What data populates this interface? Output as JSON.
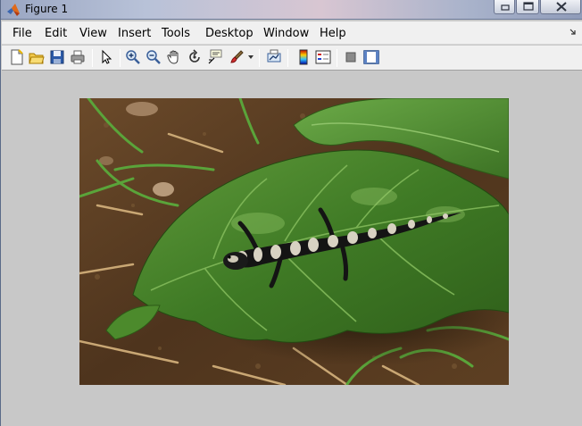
{
  "window": {
    "title": "Figure 1",
    "icon": "matlab-icon"
  },
  "menu": {
    "items": [
      "File",
      "Edit",
      "View",
      "Insert",
      "Tools",
      "Desktop",
      "Window",
      "Help"
    ]
  },
  "toolbar": {
    "buttons": [
      "new-figure-icon",
      "open-file-icon",
      "save-icon",
      "print-icon",
      "edit-plot-icon",
      "zoom-in-icon",
      "zoom-out-icon",
      "pan-icon",
      "rotate-3d-icon",
      "data-cursor-icon",
      "brush-icon",
      "link-plot-icon",
      "colorbar-icon",
      "legend-icon",
      "hide-plot-tools-icon",
      "show-plot-tools-icon"
    ]
  },
  "figure": {
    "content": "image-of-salamander-on-leaf"
  }
}
